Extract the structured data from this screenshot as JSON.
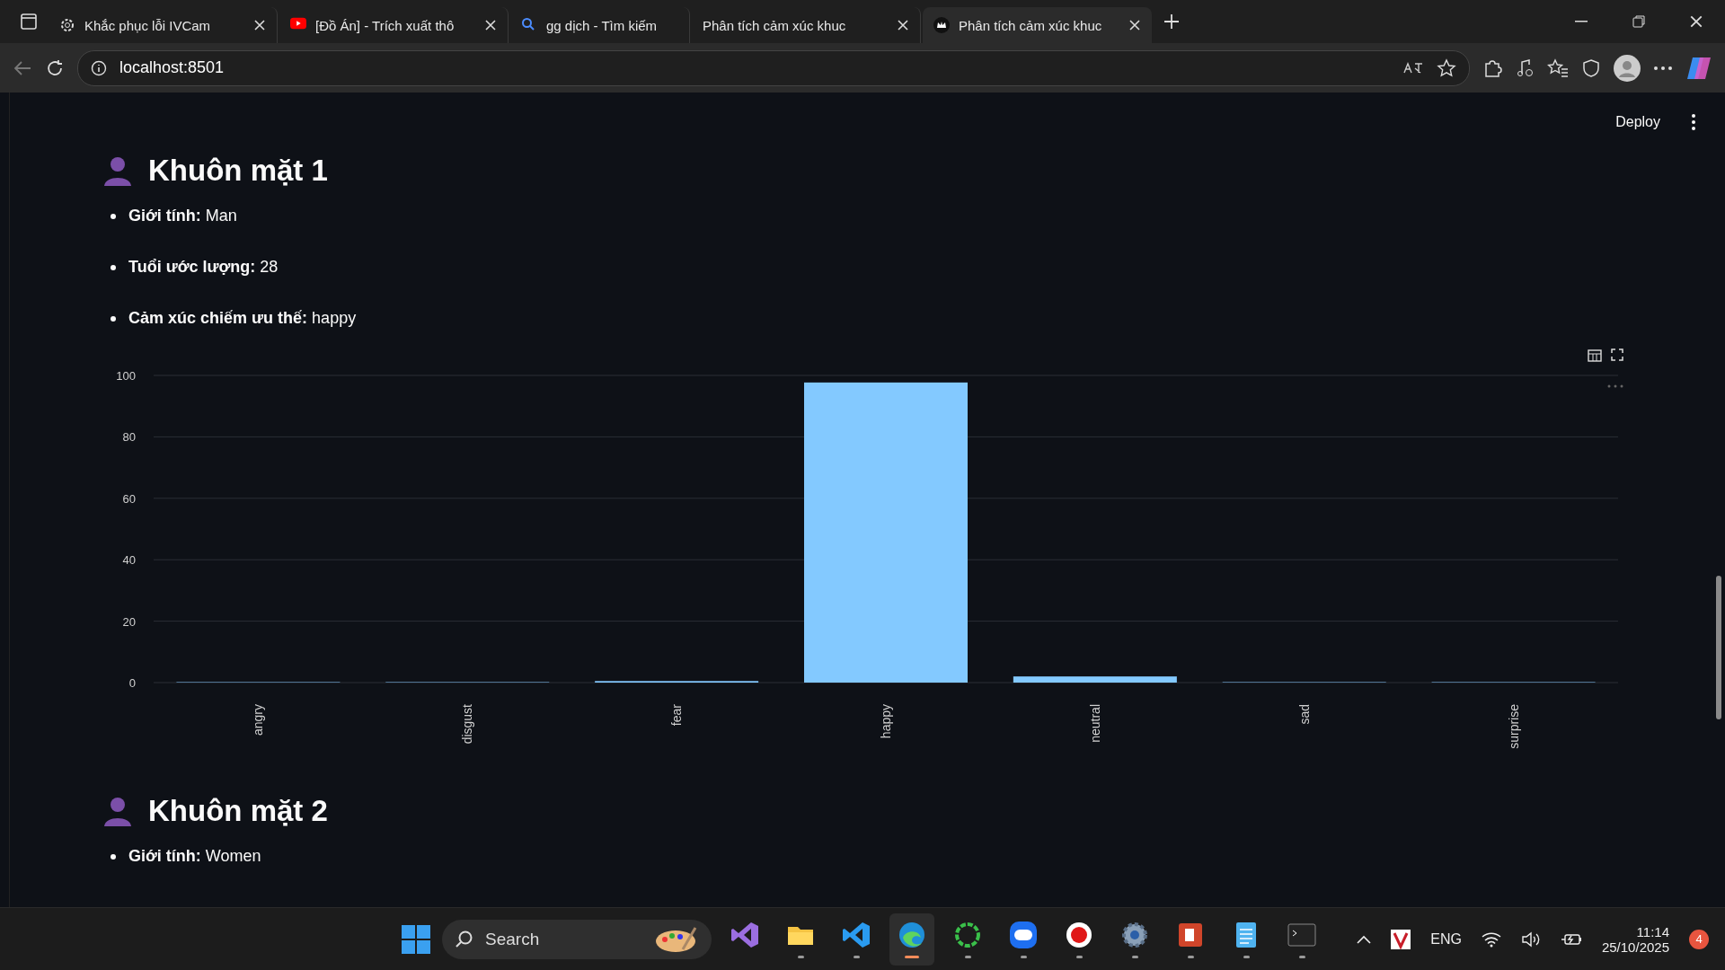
{
  "browser": {
    "tabs": [
      {
        "title": "Khắc phục lỗi IVCam",
        "kind": "gear",
        "selected": false
      },
      {
        "title": "[Đồ Án] - Trích xuất thô",
        "kind": "video",
        "selected": false
      },
      {
        "title": "gg dịch - Tìm kiếm",
        "kind": "search",
        "selected": false
      },
      {
        "title": "Phân tích cảm xúc khuc",
        "kind": "plain",
        "selected": false
      },
      {
        "title": "Phân tích cảm xúc khuc",
        "kind": "crown",
        "selected": true
      }
    ],
    "url": "localhost:8501"
  },
  "app": {
    "deploy": "Deploy",
    "faces": [
      {
        "heading": "Khuôn mặt 1",
        "facts": [
          {
            "label": "Giới tính:",
            "value": "Man"
          },
          {
            "label": "Tuổi ước lượng:",
            "value": "28"
          },
          {
            "label": "Cảm xúc chiếm ưu thế:",
            "value": "happy"
          }
        ],
        "chart_data": {
          "type": "bar",
          "categories": [
            "angry",
            "disgust",
            "fear",
            "happy",
            "neutral",
            "sad",
            "surprise"
          ],
          "values": [
            0,
            0,
            0.5,
            97.7,
            2,
            0,
            0
          ],
          "ylim": [
            0,
            100
          ],
          "yticks": [
            0,
            20,
            40,
            60,
            80,
            100
          ],
          "grid": true
        }
      },
      {
        "heading": "Khuôn mặt 2",
        "facts": [
          {
            "label": "Giới tính:",
            "value": "Women"
          }
        ]
      }
    ]
  },
  "taskbar": {
    "search": "Search",
    "apps": [
      {
        "kind": "visualstudio",
        "open": false,
        "selected": false
      },
      {
        "kind": "folder",
        "open": true,
        "selected": false
      },
      {
        "kind": "vscode",
        "open": true,
        "selected": false
      },
      {
        "kind": "edge",
        "open": true,
        "selected": true
      },
      {
        "kind": "ring",
        "open": true,
        "selected": false
      },
      {
        "kind": "zalo",
        "open": true,
        "selected": false
      },
      {
        "kind": "record",
        "open": true,
        "selected": false
      },
      {
        "kind": "settings",
        "open": true,
        "selected": false
      },
      {
        "kind": "powerpoint",
        "open": true,
        "selected": false
      },
      {
        "kind": "notepad",
        "open": true,
        "selected": false
      },
      {
        "kind": "terminal",
        "open": true,
        "selected": false
      }
    ],
    "language": "ENG",
    "time": "11:14",
    "date": "25/10/2025",
    "badge": "4"
  }
}
